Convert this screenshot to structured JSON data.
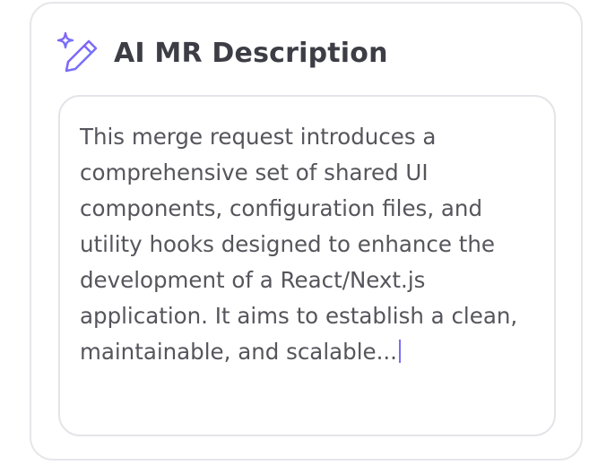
{
  "card": {
    "title": "AI MR Description",
    "icon": "sparkle-pencil-icon"
  },
  "description": {
    "text": "This merge request introduces a comprehensive set of shared UI components, configuration files, and utility hooks designed to enhance the development of a React/Next.js application. It aims to establish a clean, maintainable, and scalable..."
  },
  "colors": {
    "accent": "#7b6cf6",
    "title": "#3d3d45",
    "text": "#55555c",
    "border": "#e6e6ea"
  }
}
